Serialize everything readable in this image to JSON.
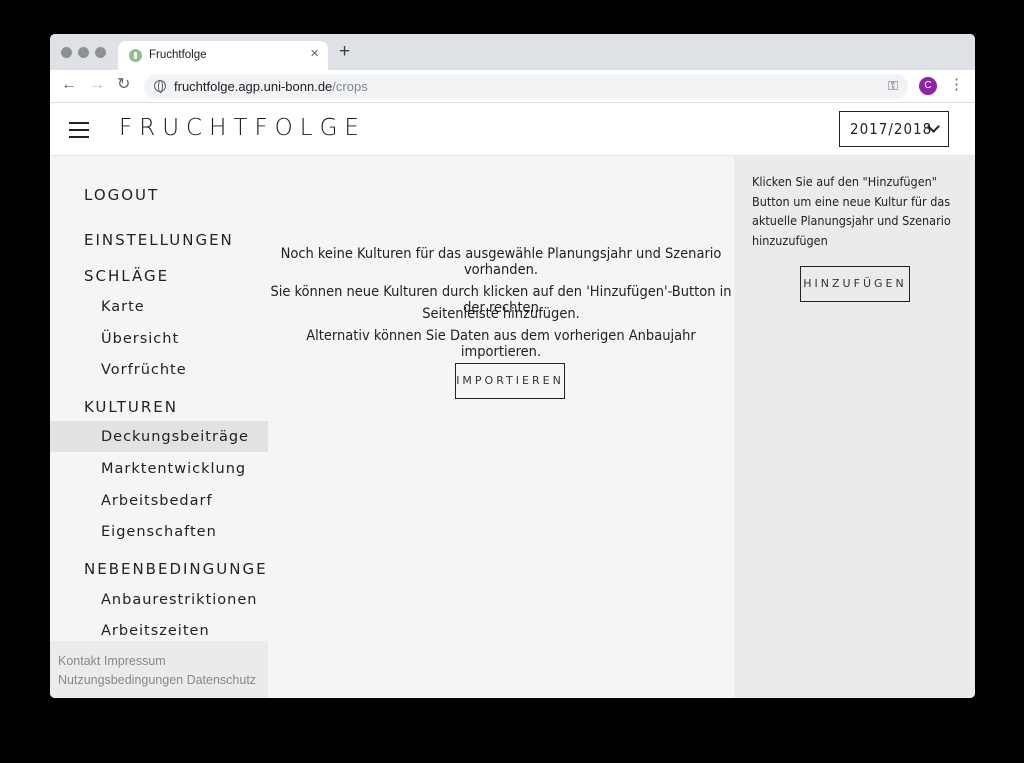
{
  "browser": {
    "tab_title": "Fruchtfolge",
    "tab_close": "×",
    "new_tab": "+",
    "url_host": "fruchtfolge.agp.uni-bonn.de",
    "url_path": "/crops",
    "profile_initial": "C",
    "back": "←",
    "forward": "→",
    "reload": "↻",
    "menu": "⋮",
    "key": "⚿"
  },
  "app": {
    "brand": "FRUCHTFOLGE",
    "year_selected": "2017/2018"
  },
  "sidebar": {
    "logout": "LOGOUT",
    "settings": "EINSTELLUNGEN",
    "fields_header": "SCHLÄGE",
    "fields_items": [
      "Karte",
      "Übersicht",
      "Vorfrüchte"
    ],
    "crops_header": "KULTUREN",
    "crops_items": [
      "Deckungsbeiträge",
      "Marktentwicklung",
      "Arbeitsbedarf",
      "Eigenschaften"
    ],
    "crops_active": "Deckungsbeiträge",
    "constraints_header": "NEBENBEDINGUNGEN",
    "constraints_items": [
      "Anbaurestriktionen",
      "Arbeitszeiten"
    ],
    "footer_line1": "Kontakt Impressum",
    "footer_line2": "Nutzungsbedingungen Datenschutz"
  },
  "main": {
    "empty_message": "Noch keine Kulturen für das ausgewähle Planungsjahr und Szenario vorhanden.",
    "hint_line1": "Sie können neue Kulturen durch klicken auf den 'Hinzufügen'-Button in der rechten",
    "hint_line2": "Seitenleiste hinzufügen.",
    "hint_line3": "Alternativ können Sie Daten aus dem vorherigen Anbaujahr importieren.",
    "import_button": "IMPORTIEREN"
  },
  "rightbar": {
    "hint": "Klicken Sie auf den \"Hinzufügen\" Button um eine neue Kultur für das aktuelle Planungsjahr und Szenario hinzuzufügen",
    "add_button": "HINZUFÜGEN"
  }
}
